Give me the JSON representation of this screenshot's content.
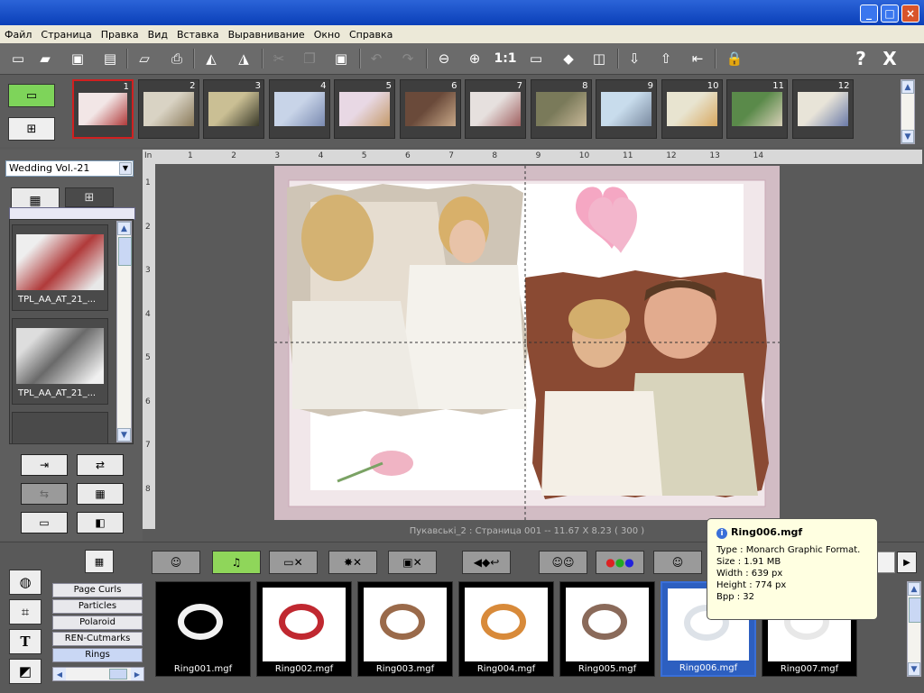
{
  "window": {
    "min": "_",
    "max": "□",
    "close": "×"
  },
  "menu": [
    "Файл",
    "Страница",
    "Правка",
    "Вид",
    "Вставка",
    "Выравнивание",
    "Окно",
    "Справка"
  ],
  "toolbar": {
    "icons": [
      "new-page-icon",
      "open-icon",
      "save-icon",
      "save-as-icon",
      "open-folder-icon",
      "print-icon",
      "export-icon",
      "edit-icon",
      "cut-icon",
      "copy-icon",
      "paste-icon",
      "undo-icon",
      "redo-icon",
      "zoom-out-icon",
      "zoom-in-icon",
      "zoom-actual-icon",
      "fit-page-icon",
      "fit-window-icon",
      "two-pages-icon",
      "import-icon",
      "upload-icon",
      "arrange-icon",
      "lock-icon",
      "help-icon",
      "close-x-icon"
    ],
    "zoom_label": "1:1",
    "help_label": "?",
    "close_label": "X"
  },
  "filmstrip": {
    "pages": [
      {
        "num": "1",
        "selected": true
      },
      {
        "num": "2"
      },
      {
        "num": "3"
      },
      {
        "num": "4"
      },
      {
        "num": "5"
      },
      {
        "num": "6"
      },
      {
        "num": "7"
      },
      {
        "num": "8"
      },
      {
        "num": "9"
      },
      {
        "num": "10"
      },
      {
        "num": "11"
      },
      {
        "num": "12"
      }
    ]
  },
  "left_panel": {
    "album_select": "Wedding Vol.-21",
    "templates": [
      {
        "label": "TPL_AA_AT_21_..."
      },
      {
        "label": "TPL_AA_AT_21_..."
      }
    ]
  },
  "ruler": {
    "h_ticks": [
      "In",
      "1",
      "2",
      "3",
      "4",
      "5",
      "6",
      "7",
      "8",
      "9",
      "10",
      "11",
      "12",
      "13",
      "14"
    ],
    "v_ticks": [
      "1",
      "2",
      "3",
      "4",
      "5",
      "6",
      "7",
      "8"
    ]
  },
  "canvas": {
    "caption": "Пукавські_2 : Страница 001 -- 11.67 X 8.23 ( 300 )"
  },
  "bottom": {
    "categories": [
      {
        "label": "Page Curls"
      },
      {
        "label": "Particles"
      },
      {
        "label": "Polaroid"
      },
      {
        "label": "REN-Cutmarks"
      },
      {
        "label": "Rings",
        "selected": true
      }
    ],
    "rings": [
      {
        "label": "Ring001.mgf"
      },
      {
        "label": "Ring002.mgf"
      },
      {
        "label": "Ring003.mgf"
      },
      {
        "label": "Ring004.mgf"
      },
      {
        "label": "Ring005.mgf"
      },
      {
        "label": "Ring006.mgf",
        "selected": true
      },
      {
        "label": "Ring007.mgf"
      }
    ]
  },
  "tooltip": {
    "title": "Ring006.mgf",
    "type": "Type : Monarch Graphic Format.",
    "size": "Size : 1.91 MB",
    "width": "Width : 639 px",
    "height": "Height : 774 px",
    "bpp": "Bpp : 32"
  },
  "colors": {
    "accent": "#0a3fb8",
    "selection": "#d02020",
    "highlight": "#3a6fd8"
  }
}
